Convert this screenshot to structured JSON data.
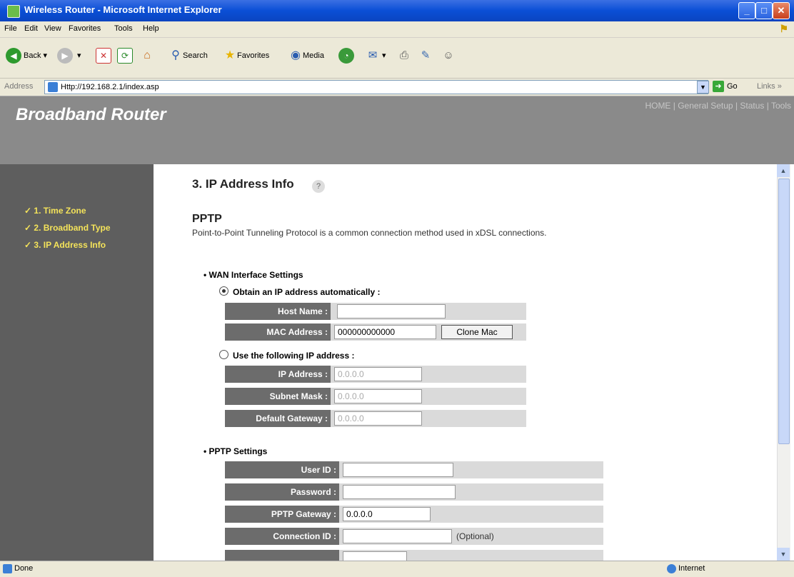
{
  "window": {
    "title": "Wireless Router - Microsoft Internet Explorer",
    "minimize": "_",
    "maximize": "□",
    "close": "✕"
  },
  "menu": [
    "File",
    "Edit",
    "View",
    "Favorites",
    "Tools",
    "Help"
  ],
  "toolbar": {
    "back": "Back",
    "search": "Search",
    "favorites": "Favorites",
    "media": "Media"
  },
  "address": {
    "label": "Address",
    "url": "Http://192.168.2.1/index.asp",
    "go": "Go",
    "links": "Links"
  },
  "header": {
    "brand": "Broadband Router",
    "nav": "HOME | General Setup | Status | Tools"
  },
  "sidebar": {
    "items": [
      {
        "label": "1. Time Zone"
      },
      {
        "label": "2. Broadband Type"
      },
      {
        "label": "3. IP Address Info"
      }
    ]
  },
  "content": {
    "page_title": "3. IP Address Info",
    "section_title": "PPTP",
    "section_desc": "Point-to-Point Tunneling Protocol is a common connection method used in xDSL connections.",
    "wan": {
      "heading": "WAN Interface Settings",
      "auto_label": "Obtain an IP address automatically :",
      "host_name_label": "Host Name :",
      "host_name_value": "",
      "mac_label": "MAC Address :",
      "mac_value": "000000000000",
      "clone_mac": "Clone Mac",
      "static_label": "Use the following IP address :",
      "ip_label": "IP Address :",
      "ip_value": "0.0.0.0",
      "subnet_label": "Subnet Mask :",
      "subnet_value": "0.0.0.0",
      "gateway_label": "Default Gateway :",
      "gateway_value": "0.0.0.0"
    },
    "pptp": {
      "heading": "PPTP Settings",
      "user_id_label": "User ID :",
      "user_id_value": "",
      "password_label": "Password :",
      "password_value": "",
      "gateway_label": "PPTP Gateway :",
      "gateway_value": "0.0.0.0",
      "conn_id_label": "Connection ID :",
      "conn_id_value": "",
      "optional": "(Optional)"
    }
  },
  "status": {
    "text": "Done",
    "zone": "Internet"
  }
}
